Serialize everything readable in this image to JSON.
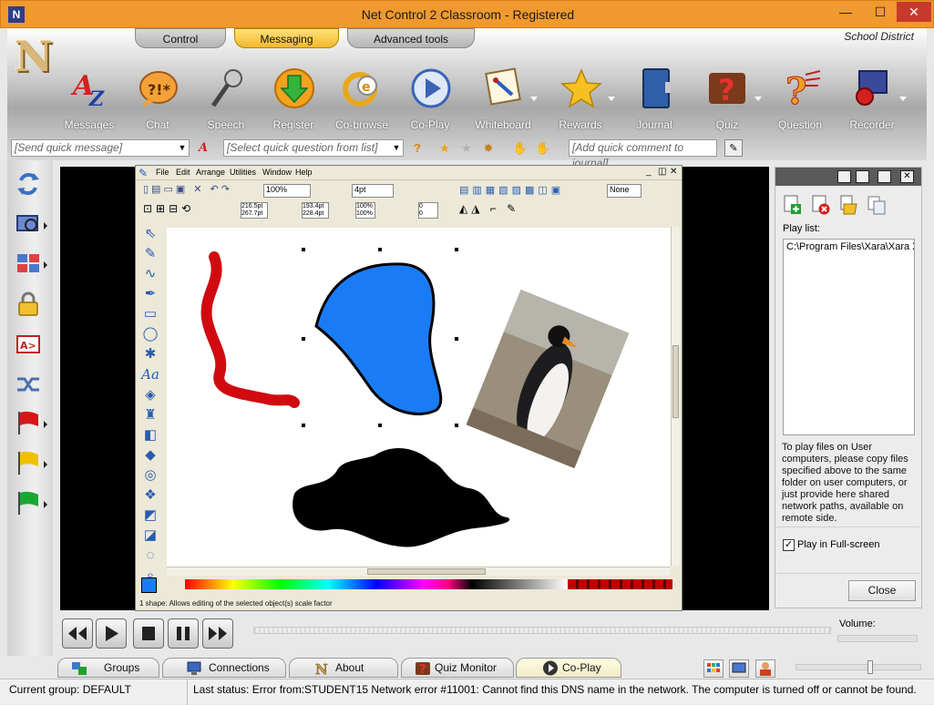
{
  "window": {
    "title": "Net Control 2 Classroom - Registered",
    "minimize_glyph": "—",
    "maximize_glyph": "☐",
    "close_glyph": "✕"
  },
  "ribbon": {
    "tabs": [
      {
        "label": "Control",
        "active": false
      },
      {
        "label": "Messaging",
        "active": true
      },
      {
        "label": "Advanced tools",
        "active": false
      }
    ],
    "school": "School District",
    "tools": [
      {
        "label": "Messages",
        "icon": "messages-az-icon",
        "dropdown": false
      },
      {
        "label": "Chat",
        "icon": "chat-bubble-icon",
        "dropdown": false
      },
      {
        "label": "Speech",
        "icon": "microphone-icon",
        "dropdown": false
      },
      {
        "label": "Register",
        "icon": "register-arrow-icon",
        "dropdown": false
      },
      {
        "label": "Co-browse",
        "icon": "co-browse-icon",
        "dropdown": false
      },
      {
        "label": "Co-Play",
        "icon": "co-play-icon",
        "dropdown": false
      },
      {
        "label": "Whiteboard",
        "icon": "whiteboard-icon",
        "dropdown": true
      },
      {
        "label": "Rewards",
        "icon": "star-icon",
        "dropdown": true
      },
      {
        "label": "Journal",
        "icon": "journal-book-icon",
        "dropdown": false
      },
      {
        "label": "Quiz",
        "icon": "quiz-icon",
        "dropdown": true
      },
      {
        "label": "Question",
        "icon": "question-icon",
        "dropdown": false
      },
      {
        "label": "Recorder",
        "icon": "recorder-icon",
        "dropdown": true
      }
    ]
  },
  "quickbar": {
    "message_placeholder": "[Send quick message]",
    "question_placeholder": "[Select quick question from list]",
    "journal_placeholder": "[Add quick comment to journal]"
  },
  "xara": {
    "menu": [
      "File",
      "Edit",
      "Arrange",
      "Utilities",
      "Window",
      "Help"
    ],
    "zoom": "100%",
    "line_width": "4pt",
    "arrow_none": "None",
    "coords": {
      "x": "216.5pt",
      "y": "267.7pt",
      "w": "193.4pt",
      "h": "228.4pt",
      "sx": "100%",
      "sy": "100%",
      "rot": "0"
    },
    "status": "1 shape: Allows editing of the selected object(s) scale factor"
  },
  "right_panel": {
    "playlist_label": "Play list:",
    "playlist_items": [
      "C:\\Program Files\\Xara\\Xara X"
    ],
    "note": "To play files on User computers, please copy files specified above to the same folder on user computers, or just provide here shared network paths, available on remote side.",
    "fullscreen_label": "Play in Full-screen",
    "fullscreen_checked": true,
    "close_label": "Close"
  },
  "media": {
    "volume_label": "Volume:"
  },
  "bottom_tabs": [
    {
      "label": "Groups",
      "icon": "groups-icon",
      "active": false
    },
    {
      "label": "Connections",
      "icon": "connections-icon",
      "active": false
    },
    {
      "label": "About",
      "icon": "about-icon",
      "active": false
    },
    {
      "label": "Quiz Monitor",
      "icon": "quiz-monitor-icon",
      "active": false
    },
    {
      "label": "Co-Play",
      "icon": "co-play-tab-icon",
      "active": true
    }
  ],
  "status": {
    "group": "Current group: DEFAULT",
    "last": "Last status: Error from:STUDENT15 Network error #11001: Cannot find this DNS name in the network. The computer is turned off or cannot be found."
  },
  "colors": {
    "titlebar": "#f0992e",
    "accent_tab": "#f2b72c",
    "blob_blue": "#1a7cf5",
    "squiggle_red": "#d10a10"
  }
}
